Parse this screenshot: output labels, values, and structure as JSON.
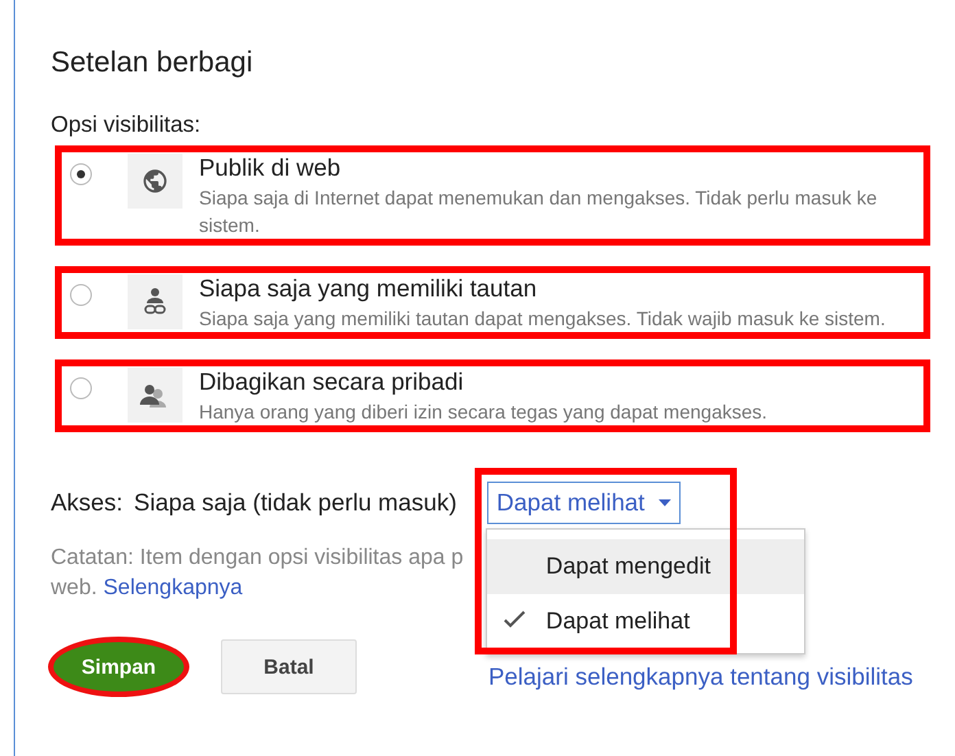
{
  "title": "Setelan berbagi",
  "visibility_label": "Opsi visibilitas:",
  "options": [
    {
      "kind": "globe",
      "title": "Publik di web",
      "description": "Siapa saja di Internet dapat menemukan dan mengakses. Tidak perlu masuk ke sistem.",
      "selected": true,
      "highlighted": true
    },
    {
      "kind": "link",
      "title": "Siapa saja yang memiliki tautan",
      "description": "Siapa saja yang memiliki tautan dapat mengakses. Tidak wajib masuk ke sistem.",
      "selected": false,
      "highlighted": true
    },
    {
      "kind": "private",
      "title": "Dibagikan secara pribadi",
      "description": "Hanya orang yang diberi izin secara tegas yang dapat mengakses.",
      "selected": false,
      "highlighted": true
    }
  ],
  "access": {
    "label": "Akses:",
    "value": "Siapa saja (tidak perlu masuk)",
    "dropdown": "Dapat melihat",
    "highlighted": true,
    "menu": [
      {
        "label": "Dapat mengedit",
        "selected": false,
        "hovered": true
      },
      {
        "label": "Dapat melihat",
        "selected": true,
        "hovered": false
      }
    ]
  },
  "note": {
    "line_1": "Catatan: Item dengan opsi visibilitas apa p",
    "line_2": "web.",
    "link": "Selengkapnya"
  },
  "buttons": [
    {
      "kind": "primary",
      "label": "Simpan",
      "highlighted": true
    },
    {
      "kind": "secondary",
      "label": "Batal",
      "highlighted": false
    }
  ],
  "learn_more": "Pelajari selengkapnya tentang visibilitas"
}
